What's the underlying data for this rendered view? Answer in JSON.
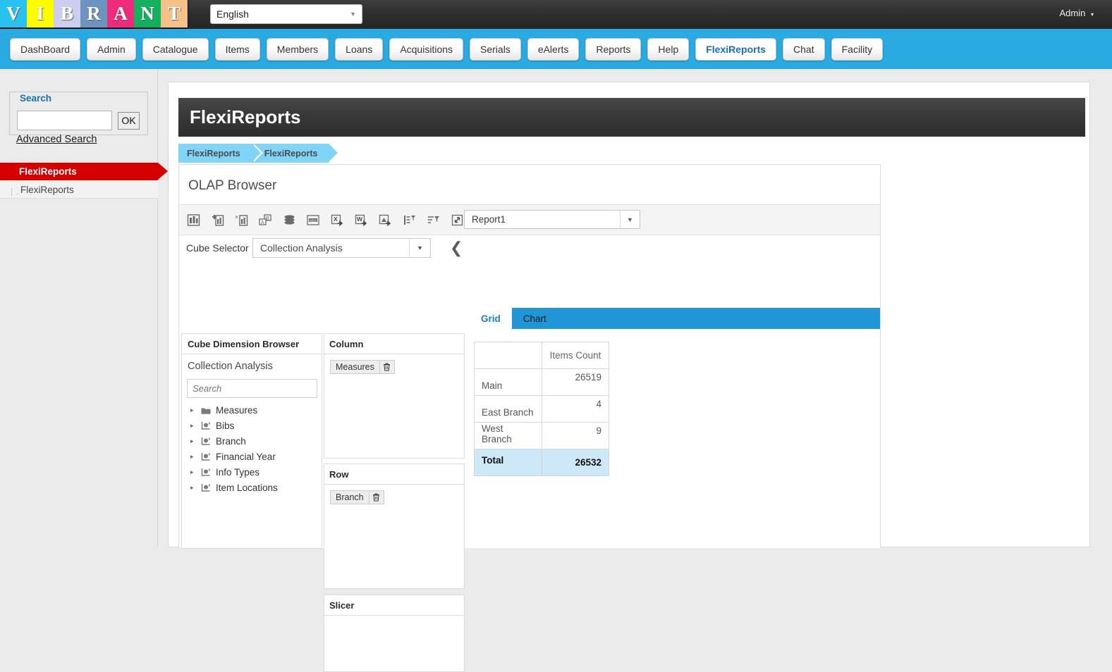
{
  "topbar": {
    "logo_letters": [
      {
        "ch": "V",
        "bg": "#29c1ef"
      },
      {
        "ch": "I",
        "bg": "#fdfd00"
      },
      {
        "ch": "B",
        "bg": "#cdcdf0"
      },
      {
        "ch": "R",
        "bg": "#6d94bf"
      },
      {
        "ch": "A",
        "bg": "#ed2a7b"
      },
      {
        "ch": "N",
        "bg": "#13b05e"
      },
      {
        "ch": "T",
        "bg": "#f5c089"
      }
    ],
    "language": "English",
    "language_caret": "▼",
    "admin_label": "Admin",
    "admin_caret": "▾"
  },
  "nav": {
    "tabs": [
      {
        "label": "DashBoard",
        "active": false
      },
      {
        "label": "Admin",
        "active": false
      },
      {
        "label": "Catalogue",
        "active": false
      },
      {
        "label": "Items",
        "active": false
      },
      {
        "label": "Members",
        "active": false
      },
      {
        "label": "Loans",
        "active": false
      },
      {
        "label": "Acquisitions",
        "active": false
      },
      {
        "label": "Serials",
        "active": false
      },
      {
        "label": "eAlerts",
        "active": false
      },
      {
        "label": "Reports",
        "active": false
      },
      {
        "label": "Help",
        "active": false
      },
      {
        "label": "FlexiReports",
        "active": true
      },
      {
        "label": "Chat",
        "active": false
      },
      {
        "label": "Facility",
        "active": false
      }
    ]
  },
  "sidebar": {
    "search_legend": "Search",
    "search_value": "",
    "search_placeholder": "",
    "ok_label": "OK",
    "advanced_search": "Advanced Search",
    "active_menu": "FlexiReports",
    "sub_menu": "FlexiReports",
    "sub_menu_dots": "…"
  },
  "page": {
    "header_title": "FlexiReports",
    "breadcrumb": [
      "FlexiReports",
      "FlexiReports"
    ],
    "olap_title": "OLAP Browser"
  },
  "toolbar": {
    "icons": [
      {
        "name": "cube-chart-icon",
        "title": "Cube"
      },
      {
        "name": "add-chart-icon",
        "title": "Add"
      },
      {
        "name": "remove-chart-icon",
        "title": "Remove"
      },
      {
        "name": "swap-axes-icon",
        "title": "Swap Axes"
      },
      {
        "name": "database-icon",
        "title": "Database"
      },
      {
        "name": "mdx-icon",
        "title": "MDX"
      },
      {
        "name": "export-excel-icon",
        "title": "Export Excel"
      },
      {
        "name": "export-word-icon",
        "title": "Export Word"
      },
      {
        "name": "export-pdf-icon",
        "title": "Export PDF"
      },
      {
        "name": "sort-filter-icon",
        "title": "Sort"
      },
      {
        "name": "filter-icon",
        "title": "Filter"
      },
      {
        "name": "fullscreen-icon",
        "title": "Full Screen"
      }
    ],
    "report_name": "Report1",
    "report_caret": "▼"
  },
  "cube": {
    "selector_label": "Cube Selector",
    "selected": "Collection Analysis",
    "caret": "▼",
    "collapse_arrow": "❮"
  },
  "view_tabs": [
    {
      "label": "Grid",
      "active": true
    },
    {
      "label": "Chart",
      "active": false
    }
  ],
  "dimension_browser": {
    "header": "Cube Dimension Browser",
    "cube_name": "Collection Analysis",
    "search_placeholder": "Search",
    "search_value": "",
    "items": [
      {
        "label": "Measures",
        "icon": "folder-icon",
        "arrow": "▸"
      },
      {
        "label": "Bibs",
        "icon": "dimension-icon",
        "arrow": "▸"
      },
      {
        "label": "Branch",
        "icon": "dimension-icon",
        "arrow": "▸"
      },
      {
        "label": "Financial Year",
        "icon": "dimension-icon",
        "arrow": "▸"
      },
      {
        "label": "Info Types",
        "icon": "dimension-icon",
        "arrow": "▸"
      },
      {
        "label": "Item Locations",
        "icon": "dimension-icon",
        "arrow": "▸"
      }
    ]
  },
  "panels": {
    "column": {
      "header": "Column",
      "chips": [
        {
          "label": "Measures"
        }
      ]
    },
    "row": {
      "header": "Row",
      "chips": [
        {
          "label": "Branch"
        }
      ]
    },
    "slicer": {
      "header": "Slicer",
      "chips": []
    }
  },
  "chart_data": {
    "type": "table",
    "title": "Items Count by Branch",
    "columns": [
      "",
      "Items Count"
    ],
    "categories": [
      "Main",
      "East Branch",
      "West Branch"
    ],
    "values": [
      26519,
      4,
      9
    ],
    "total_label": "Total",
    "total_value": 26532,
    "rows": [
      {
        "label": "Main",
        "value": "26519"
      },
      {
        "label": "East Branch",
        "value": "4"
      },
      {
        "label": "West Branch",
        "value": "9"
      }
    ],
    "corner": "",
    "measure_header": "Items Count"
  },
  "colors": {
    "accent_blue": "#29abe2",
    "tab_blue": "#2196d6",
    "breadcrumb_blue": "#7fd4f7",
    "menu_red": "#d40000",
    "total_row_blue": "#cde9f7",
    "header_dark": "#2d2d2d"
  }
}
